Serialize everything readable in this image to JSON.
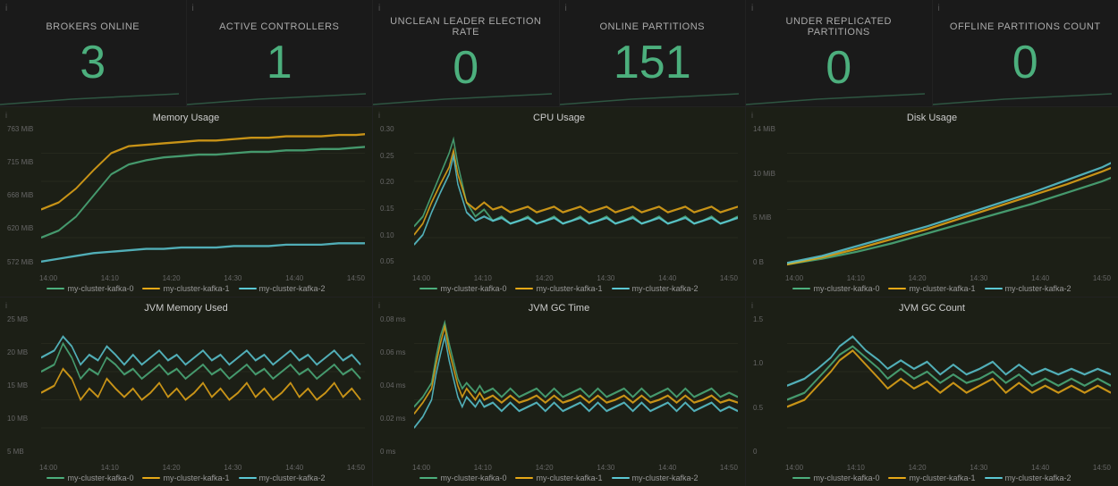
{
  "metrics": [
    {
      "id": "brokers-online",
      "title": "Brokers Online",
      "value": "3"
    },
    {
      "id": "active-controllers",
      "title": "Active Controllers",
      "value": "1"
    },
    {
      "id": "unclean-leader-election",
      "title": "Unclean Leader Election Rate",
      "value": "0"
    },
    {
      "id": "online-partitions",
      "title": "Online Partitions",
      "value": "151"
    },
    {
      "id": "under-replicated",
      "title": "Under Replicated Partitions",
      "value": "0"
    },
    {
      "id": "offline-partitions",
      "title": "Offline Partitions Count",
      "value": "0"
    }
  ],
  "charts_row1": [
    {
      "id": "memory-usage",
      "title": "Memory Usage",
      "y_labels": [
        "763 MiB",
        "715 MiB",
        "668 MiB",
        "620 MiB",
        "572 MiB"
      ],
      "x_labels": [
        "14:00",
        "14:10",
        "14:20",
        "14:30",
        "14:40",
        "14:50"
      ]
    },
    {
      "id": "cpu-usage",
      "title": "CPU Usage",
      "y_labels": [
        "0.30",
        "0.25",
        "0.20",
        "0.15",
        "0.10",
        "0.05"
      ],
      "x_labels": [
        "14:00",
        "14:10",
        "14:20",
        "14:30",
        "14:40",
        "14:50"
      ]
    },
    {
      "id": "disk-usage",
      "title": "Disk Usage",
      "y_labels": [
        "14 MiB",
        "10 MiB",
        "5 MiB",
        "0 B"
      ],
      "x_labels": [
        "14:00",
        "14:10",
        "14:20",
        "14:30",
        "14:40",
        "14:50"
      ]
    }
  ],
  "charts_row2": [
    {
      "id": "jvm-memory-used",
      "title": "JVM Memory Used",
      "y_labels": [
        "25 MB",
        "20 MB",
        "15 MB",
        "10 MB",
        "5 MB"
      ],
      "x_labels": [
        "14:00",
        "14:10",
        "14:20",
        "14:30",
        "14:40",
        "14:50"
      ]
    },
    {
      "id": "jvm-gc-time",
      "title": "JVM GC Time",
      "y_labels": [
        "0.08 ms",
        "0.06 ms",
        "0.04 ms",
        "0.02 ms",
        "0 ms"
      ],
      "x_labels": [
        "14:00",
        "14:10",
        "14:20",
        "14:30",
        "14:40",
        "14:50"
      ]
    },
    {
      "id": "jvm-gc-count",
      "title": "JVM GC Count",
      "y_labels": [
        "1.5",
        "1.0",
        "0.5",
        "0"
      ],
      "x_labels": [
        "14:00",
        "14:10",
        "14:20",
        "14:30",
        "14:40",
        "14:50"
      ]
    }
  ],
  "legend": [
    {
      "label": "my-cluster-kafka-0",
      "color": "#4caf7d"
    },
    {
      "label": "my-cluster-kafka-1",
      "color": "#e6a817"
    },
    {
      "label": "my-cluster-kafka-2",
      "color": "#5bc8d4"
    }
  ]
}
